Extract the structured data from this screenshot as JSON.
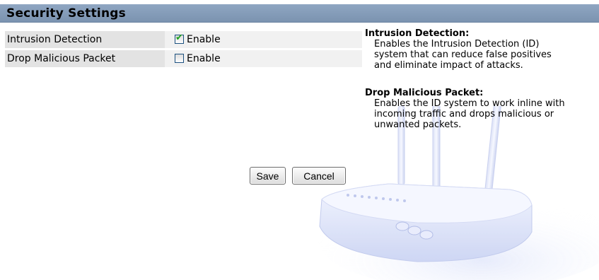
{
  "header": {
    "title": "Security Settings"
  },
  "settings": [
    {
      "label": "Intrusion Detection",
      "option_label": "Enable",
      "checked": true
    },
    {
      "label": "Drop Malicious Packet",
      "option_label": "Enable",
      "checked": false
    }
  ],
  "help": [
    {
      "heading": "Intrusion Detection:",
      "lines": [
        "Enables the Intrusion Detection (ID)",
        "system that can reduce false positives",
        "and eliminate impact of attacks."
      ]
    },
    {
      "heading": "Drop Malicious Packet:",
      "lines": [
        "Enables the ID system to work inline with",
        "incoming traffic and drops malicious or",
        "unwanted packets."
      ]
    }
  ],
  "buttons": {
    "save": "Save",
    "cancel": "Cancel"
  },
  "icons": {
    "checkmark": "check-icon",
    "router": "router-illustration-icon"
  },
  "colors": {
    "header_bar": "#8fa6c2",
    "label_cell": "#e3e3e3",
    "value_cell": "#f1f1f1",
    "checkmark": "#21a121"
  }
}
